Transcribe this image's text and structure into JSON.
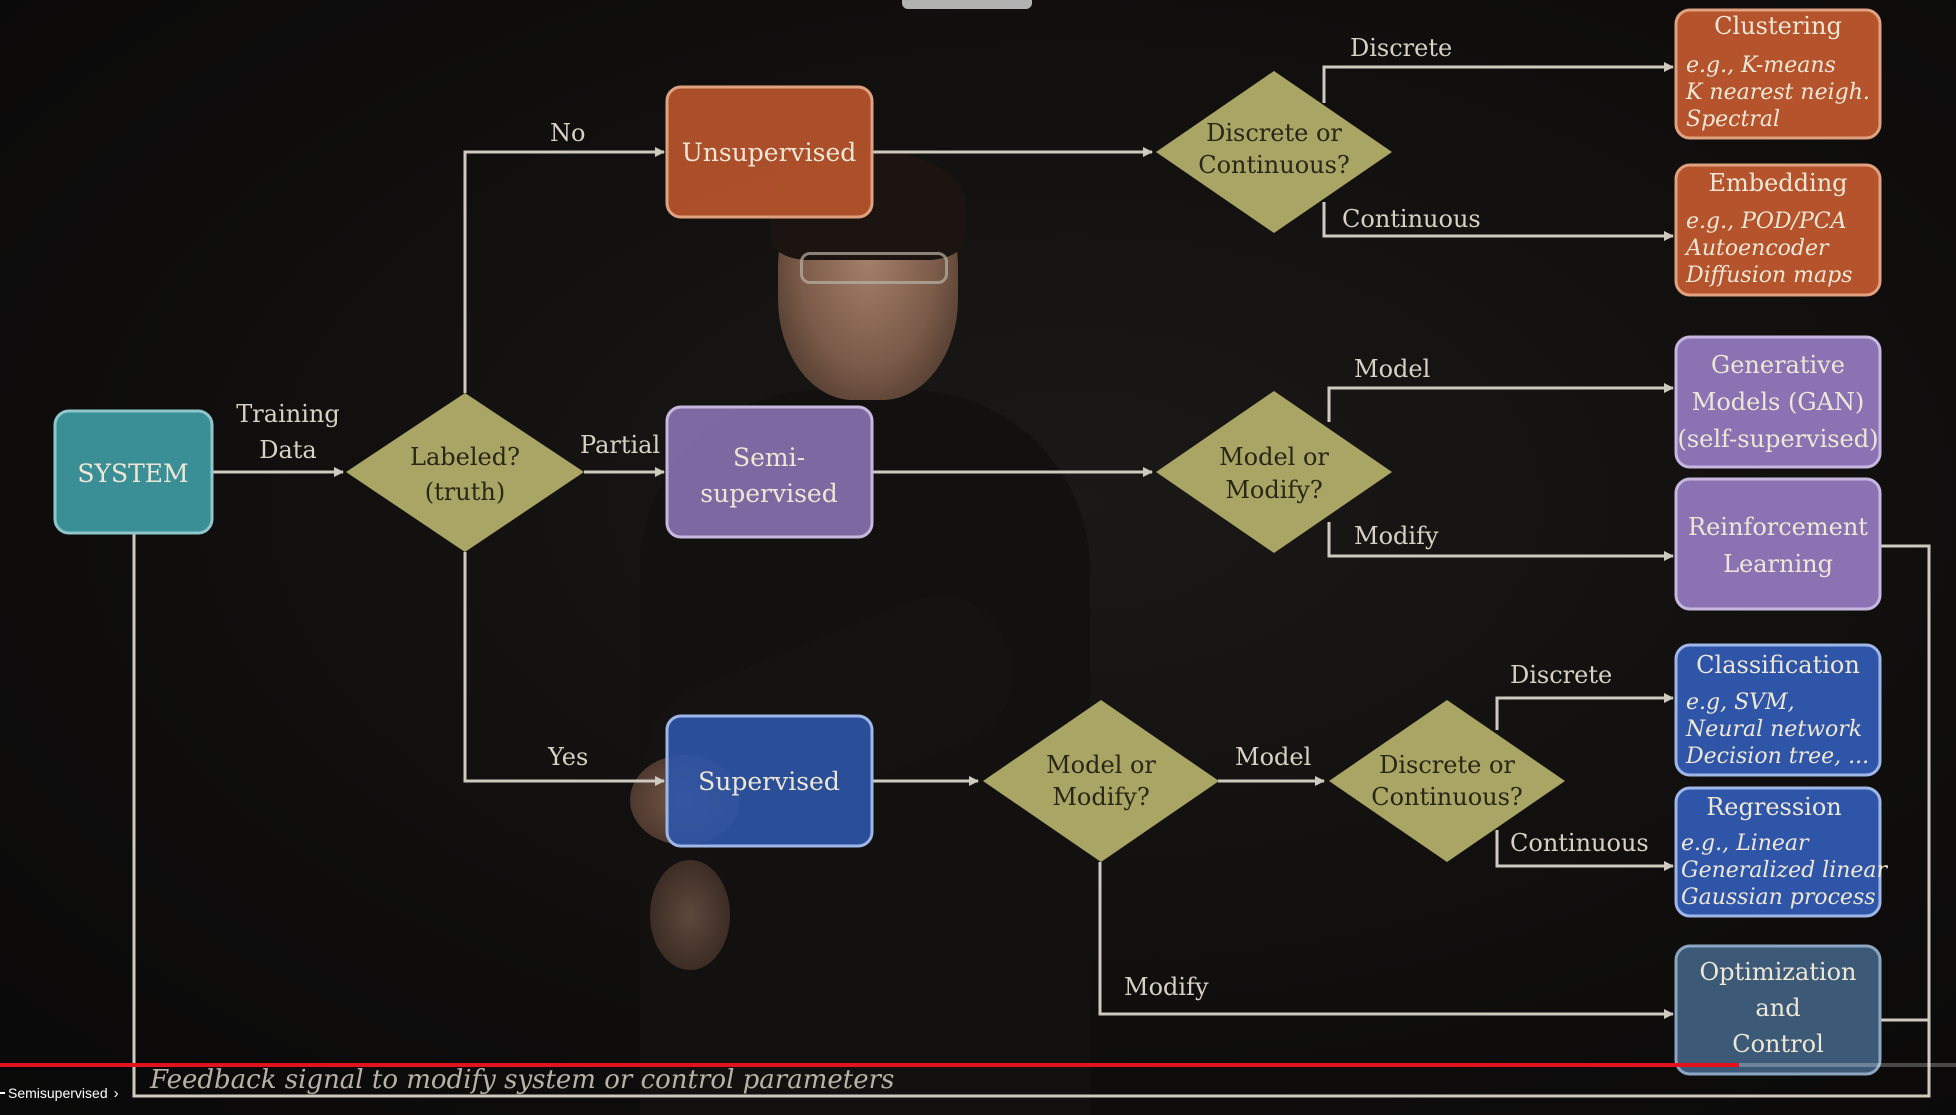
{
  "diagram": {
    "system": "SYSTEM",
    "training_data": [
      "Training",
      "Data"
    ],
    "labeled": [
      "Labeled?",
      "(truth)"
    ],
    "edges": {
      "no": "No",
      "partial": "Partial",
      "yes": "Yes",
      "discrete_top": "Discrete",
      "continuous_top": "Continuous",
      "model_mid": "Model",
      "modify_mid": "Modify",
      "model_bottom": "Model",
      "discrete_bottom": "Discrete",
      "continuous_bottom": "Continuous",
      "modify_bottom": "Modify"
    },
    "learning": {
      "unsupervised": "Unsupervised",
      "semi": [
        "Semi-",
        "supervised"
      ],
      "supervised": "Supervised"
    },
    "decisions": {
      "top": [
        "Discrete or",
        "Continuous?"
      ],
      "mid": [
        "Model or",
        "Modify?"
      ],
      "bottom_left": [
        "Model or",
        "Modify?"
      ],
      "bottom_right": [
        "Discrete or",
        "Continuous?"
      ]
    },
    "outcomes": {
      "clustering": {
        "title": "Clustering",
        "examples": [
          "e.g., K-means",
          "K nearest neigh.",
          "Spectral"
        ]
      },
      "embedding": {
        "title": "Embedding",
        "examples": [
          "e.g., POD/PCA",
          "Autoencoder",
          "Diffusion maps"
        ]
      },
      "generative": [
        "Generative",
        "Models (GAN)",
        "(self-supervised)"
      ],
      "reinforcement": [
        "Reinforcement",
        "Learning"
      ],
      "classification": {
        "title": "Classification",
        "examples": [
          "e.g, SVM,",
          "Neural network",
          "Decision tree, ..."
        ]
      },
      "regression": {
        "title": "Regression",
        "examples": [
          "e.g., Linear",
          "Generalized linear",
          "Gaussian process"
        ]
      },
      "optimization": [
        "Optimization",
        "and",
        "Control"
      ]
    },
    "feedback": "Feedback signal to modify system or control parameters"
  },
  "player": {
    "chapter": "Semisupervised",
    "progress": 0.889
  },
  "colors": {
    "system": "#3a8f97",
    "unsupervised": "#b4532c",
    "semi": "#8a72b3",
    "supervised": "#2e55a8",
    "diamond": "#a9a565",
    "optimization": "#3c5a78",
    "progress": "#e4121d"
  }
}
